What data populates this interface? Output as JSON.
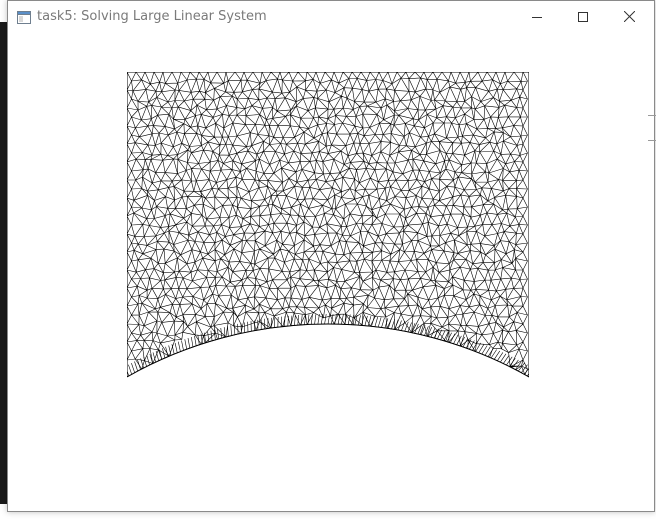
{
  "window": {
    "title": "task5: Solving Large Linear System",
    "controls": {
      "minimize": "minimize-icon",
      "maximize": "maximize-icon",
      "close": "close-icon"
    }
  },
  "mesh": {
    "description_icon": "triangular-mesh",
    "line_color": "#000000",
    "background": "#ffffff"
  }
}
